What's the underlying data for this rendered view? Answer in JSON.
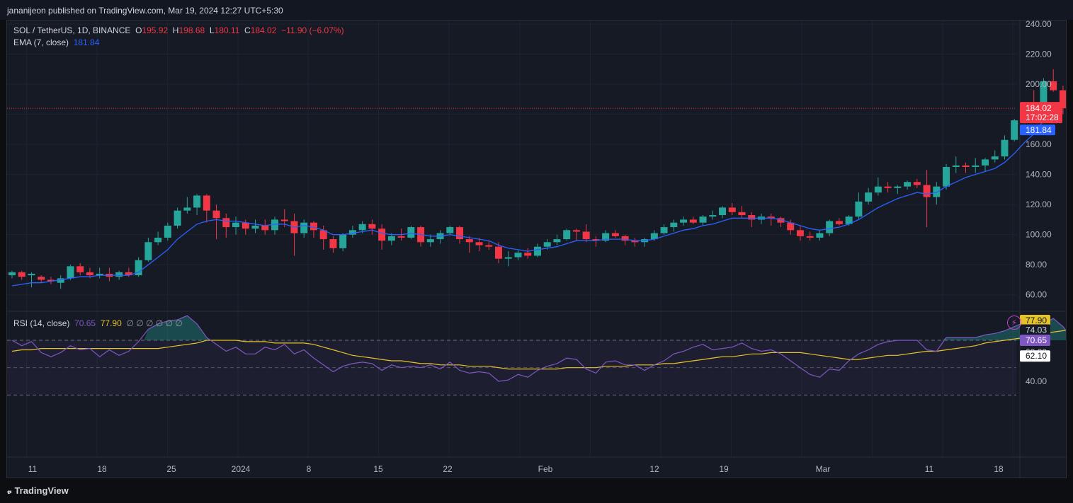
{
  "header": {
    "publisher": "jananijeon published on TradingView.com, Mar 19, 2024 12:27 UTC+5:30"
  },
  "main_legend": {
    "symbol": "SOL / TetherUS, 1D, BINANCE",
    "o_label": "O",
    "o_value": "195.92",
    "h_label": "H",
    "h_value": "198.68",
    "l_label": "L",
    "l_value": "180.11",
    "c_label": "C",
    "c_value": "184.02",
    "change": "−11.90 (−6.07%)",
    "ema_label": "EMA (7, close)",
    "ema_value": "181.84"
  },
  "rsi_legend": {
    "label": "RSI (14, close)",
    "rsi_value": "70.65",
    "ma_value": "77.90",
    "extras": "∅ ∅ ∅ ∅ ∅ ∅"
  },
  "price_axis": [
    "240.00",
    "220.00",
    "200.00",
    "180.00",
    "160.00",
    "140.00",
    "120.00",
    "100.00",
    "80.00",
    "60.00"
  ],
  "price_badges": {
    "last": "184.02",
    "countdown": "17:02:28",
    "ema": "181.84"
  },
  "rsi_axis": [
    "40.00"
  ],
  "rsi_badges": {
    "ma": "77.90",
    "mid": "74.03",
    "rsi": "70.65",
    "low": "62.10",
    "partial": "60.00"
  },
  "time_axis": [
    "11",
    "18",
    "25",
    "2024",
    "8",
    "15",
    "22",
    "Feb",
    "12",
    "19",
    "Mar",
    "11",
    "18"
  ],
  "footer": {
    "brand": "TradingView"
  },
  "colors": {
    "up": "#26a69a",
    "down": "#f23645",
    "ema": "#2962ff",
    "rsi": "#7e57c2",
    "rsi_ma": "#e6c229",
    "bg": "#161a25"
  },
  "chart_data": {
    "type": "candlestick",
    "timeframe": "1D",
    "ylim": [
      60,
      240
    ],
    "candles": [
      [
        73,
        76,
        71,
        75
      ],
      [
        75,
        76,
        70,
        72
      ],
      [
        73,
        75,
        65,
        74
      ],
      [
        72,
        73,
        68,
        70
      ],
      [
        70,
        72,
        67,
        69
      ],
      [
        68,
        73,
        64,
        71
      ],
      [
        71,
        80,
        70,
        79
      ],
      [
        79,
        81,
        73,
        75
      ],
      [
        75,
        78,
        71,
        73
      ],
      [
        73,
        78,
        71,
        74
      ],
      [
        74,
        78,
        69,
        72
      ],
      [
        72,
        76,
        70,
        75
      ],
      [
        75,
        78,
        72,
        73
      ],
      [
        73,
        85,
        72,
        83
      ],
      [
        83,
        98,
        82,
        95
      ],
      [
        95,
        102,
        93,
        98
      ],
      [
        98,
        108,
        96,
        106
      ],
      [
        106,
        118,
        104,
        116
      ],
      [
        116,
        125,
        114,
        118
      ],
      [
        118,
        127,
        113,
        126
      ],
      [
        126,
        127,
        108,
        116
      ],
      [
        116,
        120,
        97,
        111
      ],
      [
        111,
        114,
        98,
        105
      ],
      [
        105,
        112,
        100,
        108
      ],
      [
        108,
        110,
        100,
        104
      ],
      [
        104,
        110,
        101,
        106
      ],
      [
        106,
        110,
        100,
        103
      ],
      [
        103,
        112,
        100,
        110
      ],
      [
        110,
        117,
        105,
        109
      ],
      [
        109,
        114,
        86,
        101
      ],
      [
        101,
        110,
        98,
        108
      ],
      [
        108,
        109,
        98,
        103
      ],
      [
        103,
        106,
        90,
        97
      ],
      [
        97,
        99,
        88,
        91
      ],
      [
        91,
        101,
        89,
        100
      ],
      [
        100,
        106,
        98,
        103
      ],
      [
        103,
        109,
        101,
        107
      ],
      [
        107,
        110,
        100,
        104
      ],
      [
        104,
        107,
        90,
        96
      ],
      [
        96,
        101,
        93,
        99
      ],
      [
        99,
        104,
        96,
        98
      ],
      [
        98,
        106,
        97,
        105
      ],
      [
        105,
        106,
        92,
        95
      ],
      [
        95,
        100,
        92,
        97
      ],
      [
        97,
        103,
        94,
        101
      ],
      [
        101,
        106,
        100,
        105
      ],
      [
        105,
        106,
        94,
        97
      ],
      [
        97,
        99,
        88,
        95
      ],
      [
        95,
        98,
        89,
        93
      ],
      [
        93,
        96,
        90,
        92
      ],
      [
        92,
        95,
        81,
        84
      ],
      [
        84,
        89,
        79,
        85
      ],
      [
        85,
        90,
        83,
        88
      ],
      [
        88,
        91,
        84,
        86
      ],
      [
        86,
        94,
        85,
        92
      ],
      [
        92,
        97,
        90,
        95
      ],
      [
        95,
        100,
        93,
        97
      ],
      [
        97,
        104,
        96,
        103
      ],
      [
        103,
        104,
        96,
        102
      ],
      [
        102,
        107,
        95,
        97
      ],
      [
        97,
        99,
        92,
        96
      ],
      [
        96,
        103,
        95,
        101
      ],
      [
        101,
        103,
        98,
        99
      ],
      [
        99,
        100,
        93,
        96
      ],
      [
        96,
        98,
        92,
        95
      ],
      [
        95,
        98,
        92,
        97
      ],
      [
        97,
        103,
        96,
        101
      ],
      [
        101,
        107,
        100,
        105
      ],
      [
        105,
        110,
        102,
        108
      ],
      [
        108,
        112,
        106,
        110
      ],
      [
        110,
        112,
        107,
        108
      ],
      [
        108,
        113,
        106,
        112
      ],
      [
        112,
        116,
        110,
        113
      ],
      [
        113,
        119,
        111,
        118
      ],
      [
        118,
        121,
        113,
        115
      ],
      [
        115,
        119,
        111,
        113
      ],
      [
        113,
        115,
        105,
        110
      ],
      [
        110,
        114,
        107,
        112
      ],
      [
        112,
        114,
        106,
        111
      ],
      [
        111,
        112,
        105,
        108
      ],
      [
        108,
        110,
        100,
        103
      ],
      [
        103,
        106,
        96,
        99
      ],
      [
        99,
        102,
        96,
        98
      ],
      [
        98,
        103,
        96,
        101
      ],
      [
        101,
        110,
        99,
        109
      ],
      [
        109,
        111,
        106,
        107
      ],
      [
        107,
        113,
        106,
        112
      ],
      [
        112,
        128,
        110,
        122
      ],
      [
        122,
        131,
        120,
        128
      ],
      [
        128,
        138,
        126,
        132
      ],
      [
        132,
        135,
        128,
        131
      ],
      [
        131,
        133,
        127,
        132
      ],
      [
        132,
        136,
        130,
        135
      ],
      [
        135,
        137,
        131,
        133
      ],
      [
        133,
        143,
        105,
        125
      ],
      [
        125,
        135,
        120,
        132
      ],
      [
        132,
        147,
        130,
        145
      ],
      [
        145,
        152,
        141,
        146
      ],
      [
        146,
        148,
        141,
        145
      ],
      [
        145,
        151,
        141,
        146
      ],
      [
        146,
        151,
        142,
        150
      ],
      [
        150,
        156,
        148,
        152
      ],
      [
        152,
        166,
        150,
        163
      ],
      [
        163,
        177,
        162,
        176
      ],
      [
        176,
        187,
        174,
        185
      ],
      [
        185,
        196,
        179,
        184
      ],
      [
        184,
        204,
        178,
        202
      ],
      [
        202,
        210,
        195,
        196
      ],
      [
        196,
        199,
        180,
        184
      ]
    ],
    "ema7": [
      66,
      67,
      68,
      68,
      69,
      70,
      71,
      72,
      72,
      73,
      73,
      73,
      73,
      75,
      80,
      85,
      90,
      97,
      102,
      107,
      109,
      110,
      109,
      109,
      108,
      107,
      106,
      107,
      107,
      105,
      106,
      105,
      103,
      100,
      100,
      101,
      102,
      103,
      101,
      100,
      100,
      101,
      100,
      99,
      99,
      100,
      99,
      98,
      97,
      96,
      93,
      91,
      90,
      89,
      90,
      91,
      92,
      94,
      96,
      96,
      96,
      97,
      97,
      97,
      96,
      96,
      97,
      99,
      101,
      103,
      104,
      106,
      107,
      109,
      111,
      111,
      111,
      111,
      111,
      110,
      108,
      106,
      104,
      103,
      104,
      105,
      107,
      110,
      114,
      118,
      121,
      124,
      126,
      128,
      127,
      128,
      132,
      135,
      138,
      140,
      142,
      144,
      148,
      154,
      161,
      167,
      176,
      181,
      182
    ],
    "rsi": [
      70,
      66,
      69,
      61,
      58,
      61,
      66,
      63,
      64,
      58,
      63,
      59,
      62,
      69,
      78,
      82,
      84,
      85,
      88,
      82,
      72,
      67,
      62,
      65,
      60,
      60,
      65,
      63,
      67,
      60,
      63,
      57,
      52,
      47,
      51,
      53,
      54,
      53,
      48,
      52,
      50,
      51,
      50,
      52,
      49,
      54,
      48,
      46,
      47,
      46,
      40,
      41,
      45,
      43,
      48,
      51,
      53,
      57,
      56,
      49,
      46,
      54,
      55,
      52,
      52,
      48,
      52,
      55,
      60,
      62,
      65,
      67,
      63,
      64,
      65,
      68,
      64,
      62,
      63,
      60,
      55,
      50,
      45,
      43,
      49,
      48,
      55,
      60,
      63,
      67,
      69,
      70,
      70,
      70,
      63,
      62,
      72,
      72,
      72,
      72,
      74,
      75,
      77,
      80,
      83,
      84,
      82,
      86,
      80,
      71
    ],
    "rsi_ma": [
      62,
      63,
      63,
      64,
      64,
      64,
      64,
      64,
      64,
      64,
      64,
      64,
      64,
      64,
      64,
      64,
      65,
      66,
      67,
      68,
      70,
      70,
      70,
      70,
      69,
      69,
      69,
      68,
      68,
      68,
      68,
      67,
      65,
      63,
      61,
      59,
      58,
      57,
      56,
      55,
      55,
      54,
      53,
      53,
      52,
      52,
      52,
      51,
      51,
      51,
      50,
      49,
      49,
      49,
      49,
      49,
      49,
      50,
      50,
      50,
      50,
      51,
      51,
      51,
      52,
      52,
      52,
      53,
      53,
      54,
      55,
      56,
      57,
      58,
      58,
      59,
      60,
      60,
      61,
      61,
      61,
      61,
      60,
      59,
      58,
      57,
      56,
      56,
      57,
      58,
      59,
      59,
      60,
      61,
      62,
      62,
      63,
      64,
      65,
      66,
      68,
      69,
      70,
      71,
      72,
      74,
      75,
      76,
      77,
      78
    ],
    "rsi_levels": [
      70,
      50,
      30
    ]
  }
}
